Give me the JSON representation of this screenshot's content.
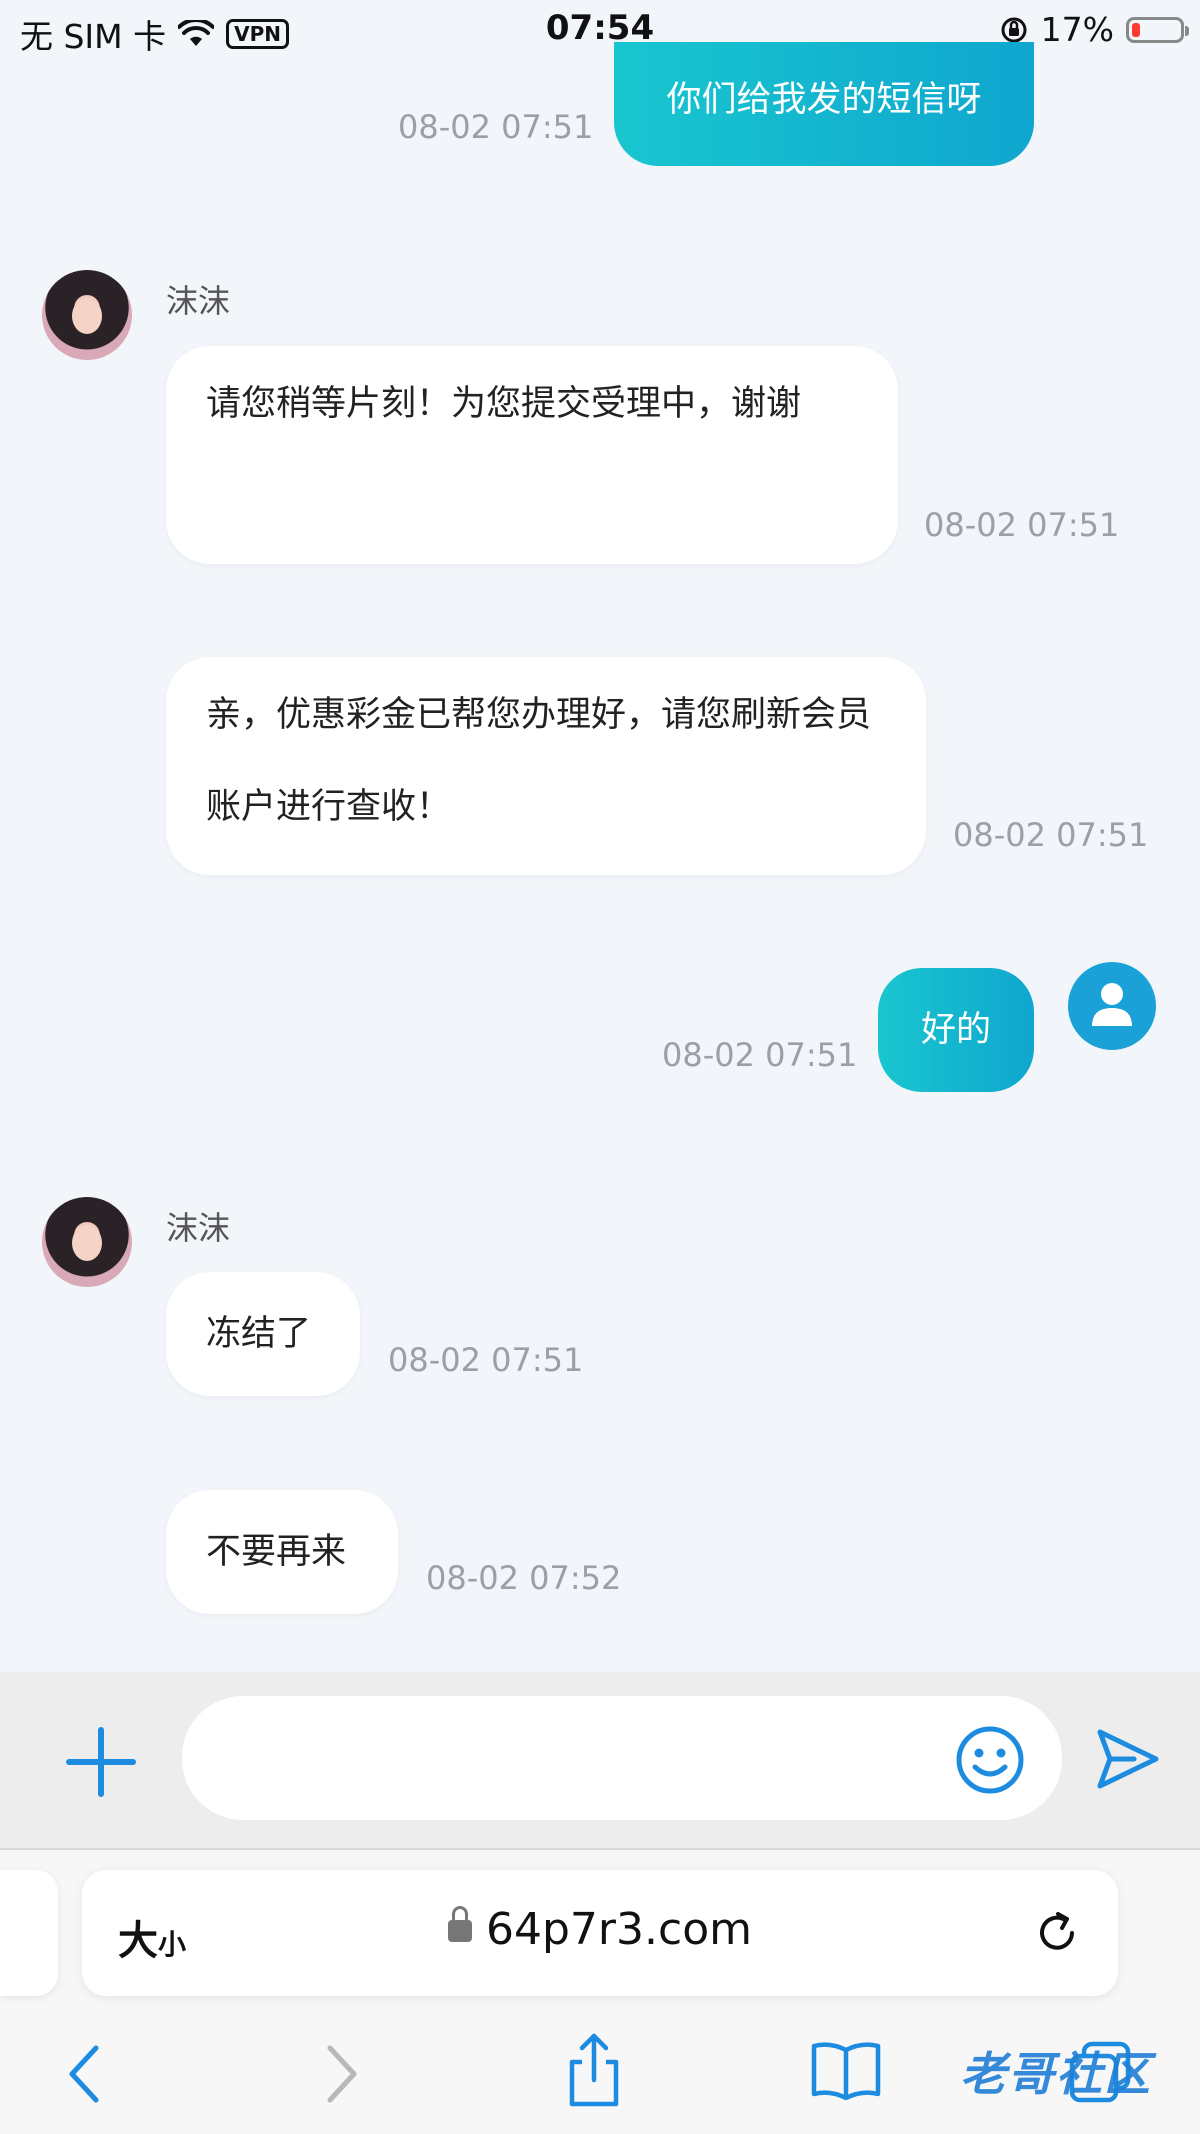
{
  "status_bar": {
    "carrier": "无 SIM 卡",
    "vpn": "VPN",
    "time": "07:54",
    "battery_percent": "17%",
    "battery_level": 0.17
  },
  "messages": [
    {
      "id": "m1",
      "direction": "out",
      "text": "你们给我发的短信呀",
      "time": "08-02 07:51"
    },
    {
      "id": "m2",
      "direction": "in",
      "sender": "沫沫",
      "text": "请您稍等片刻！为您提交受理中，谢谢",
      "time": "08-02 07:51"
    },
    {
      "id": "m3",
      "direction": "in",
      "text": "亲，优惠彩金已帮您办理好，请您刷新会员账户进行查收！",
      "time": "08-02 07:51"
    },
    {
      "id": "m4",
      "direction": "out",
      "text": "好的",
      "time": "08-02 07:51"
    },
    {
      "id": "m5",
      "direction": "in",
      "sender": "沫沫",
      "text": "冻结了",
      "time": "08-02 07:51"
    },
    {
      "id": "m6",
      "direction": "in",
      "text": "不要再来",
      "time": "08-02 07:52"
    }
  ],
  "input": {
    "value": "",
    "placeholder": ""
  },
  "browser": {
    "text_size_label_big": "大",
    "text_size_label_small": "小",
    "url": "64p7r3.com"
  },
  "watermark": "老哥社区",
  "colors": {
    "background": "#f2f5f9",
    "outgoing_bubble": "#12b5d0",
    "accent": "#1d8ce0",
    "timestamp": "#9aa0a6"
  }
}
